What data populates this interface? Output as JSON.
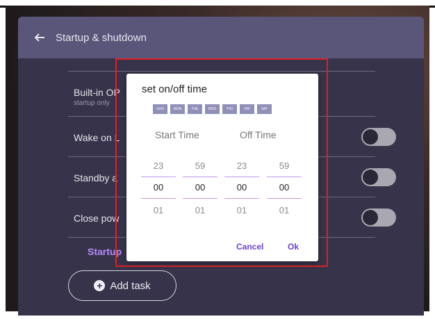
{
  "header": {
    "title": "Startup & shutdown"
  },
  "settings": {
    "rows": [
      {
        "label": "Built-in OP",
        "sub": "startup only"
      },
      {
        "label": "Wake on L"
      },
      {
        "label": "Standby a"
      },
      {
        "label": "Close pow"
      }
    ],
    "startup_link": "Startup",
    "add_task": "Add task"
  },
  "dialog": {
    "title": "set on/off time",
    "days": [
      "SUN",
      "MON",
      "TUE",
      "WED",
      "THU",
      "FRI",
      "SAT"
    ],
    "start_title": "Start Time",
    "off_title": "Off Time",
    "columns": [
      {
        "prev": "23",
        "cur": "00",
        "next": "01"
      },
      {
        "prev": "59",
        "cur": "00",
        "next": "01"
      },
      {
        "prev": "23",
        "cur": "00",
        "next": "01"
      },
      {
        "prev": "59",
        "cur": "00",
        "next": "01"
      }
    ],
    "cancel": "Cancel",
    "ok": "Ok"
  },
  "colors": {
    "panel": "#37334a",
    "header": "#5a567a",
    "accent": "#6b3fd6",
    "highlight": "#e02020"
  }
}
